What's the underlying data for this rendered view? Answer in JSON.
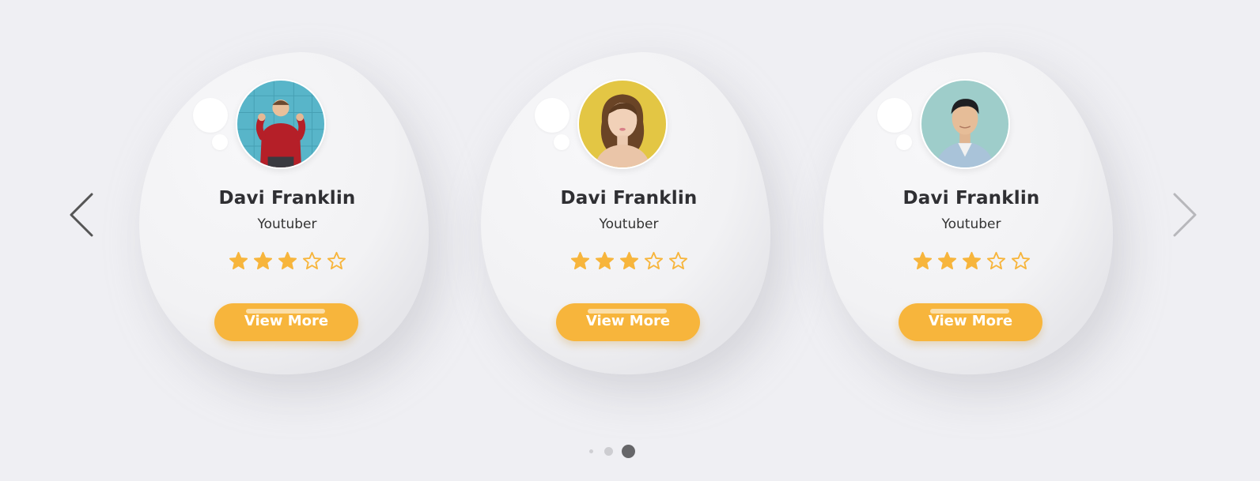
{
  "colors": {
    "background": "#efeff3",
    "card": "#f4f4f6",
    "accent": "#f7b53c",
    "text": "#2f2f33"
  },
  "navigation": {
    "prev_icon": "chevron-left-icon",
    "next_icon": "chevron-right-icon"
  },
  "cards": [
    {
      "name": "Davi Franklin",
      "role": "Youtuber",
      "rating": 3,
      "rating_max": 5,
      "button_label": "View More",
      "avatar": "man-red-sweater-photo"
    },
    {
      "name": "Davi Franklin",
      "role": "Youtuber",
      "rating": 3,
      "rating_max": 5,
      "button_label": "View More",
      "avatar": "woman-yellow-background-photo"
    },
    {
      "name": "Davi Franklin",
      "role": "Youtuber",
      "rating": 3,
      "rating_max": 5,
      "button_label": "View More",
      "avatar": "man-denim-shirt-photo"
    }
  ],
  "pagination": {
    "count": 3,
    "active_index": 2
  }
}
